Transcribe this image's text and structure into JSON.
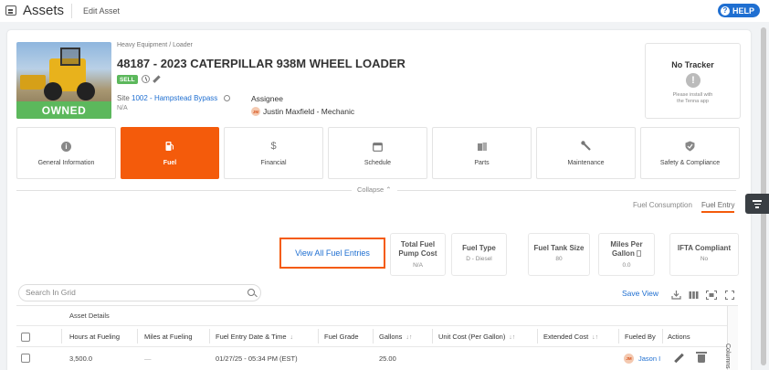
{
  "header": {
    "app_title": "Assets",
    "page_subtitle": "Edit Asset",
    "help_label": "HELP"
  },
  "asset": {
    "category": "Heavy Equipment / Loader",
    "name": "48187 - 2023 CATERPILLAR 938M WHEEL LOADER",
    "sell_badge": "SELL",
    "ownership_badge": "OWNED",
    "site_prefix": "Site",
    "site_link": "1002 - Hampstead Bypass",
    "site_secondary": "N/A",
    "assignee_label": "Assignee",
    "assignee_initials": "JM",
    "assignee_name": "Justin Maxfield - Mechanic"
  },
  "tracker": {
    "title": "No Tracker",
    "note_line1": "Please install with",
    "note_line2": "the Tenna app"
  },
  "tabs": [
    {
      "label": "General Information",
      "icon": "info-icon",
      "active": false
    },
    {
      "label": "Fuel",
      "icon": "fuel-icon",
      "active": true
    },
    {
      "label": "Financial",
      "icon": "dollar-icon",
      "active": false
    },
    {
      "label": "Schedule",
      "icon": "calendar-icon",
      "active": false
    },
    {
      "label": "Parts",
      "icon": "parts-icon",
      "active": false
    },
    {
      "label": "Maintenance",
      "icon": "wrench-icon",
      "active": false
    },
    {
      "label": "Safety & Compliance",
      "icon": "shield-check-icon",
      "active": false
    }
  ],
  "collapse_label": "Collapse ⌃",
  "sub_tabs": {
    "consumption": "Fuel Consumption",
    "entry": "Fuel Entry"
  },
  "fuel": {
    "view_all_label": "View All Fuel Entries",
    "stats": [
      {
        "title_line1": "Total Fuel",
        "title_line2": "Pump Cost",
        "value": "N/A"
      },
      {
        "title_line1": "Fuel Type",
        "title_line2": "",
        "value": "D - Diesel"
      },
      {
        "title_line1": "Fuel Tank Size",
        "title_line2": "",
        "value": "80"
      },
      {
        "title_line1": "Miles Per",
        "title_line2": "Gallon",
        "value": "0.0"
      },
      {
        "title_line1": "IFTA Compliant",
        "title_line2": "",
        "value": "No"
      }
    ]
  },
  "grid": {
    "search_placeholder": "Search In Grid",
    "save_view_label": "Save View",
    "group_header": "Asset Details",
    "columns": {
      "hours": "Hours at Fueling",
      "miles": "Miles at Fueling",
      "date": "Fuel Entry Date & Time",
      "grade": "Fuel Grade",
      "gallons": "Gallons",
      "unit_cost": "Unit Cost (Per Gallon)",
      "extended": "Extended Cost",
      "fueled_by": "Fueled By",
      "actions": "Actions"
    },
    "columns_panel_label": "Columns",
    "rows": [
      {
        "hours": "3,500.0",
        "miles": "—",
        "date": "01/27/25 - 05:34 PM (EST)",
        "grade": "",
        "gallons": "25.00",
        "unit_cost": "",
        "extended": "",
        "fueled_by_initials": "JM",
        "fueled_by": "Jason I"
      }
    ]
  },
  "colors": {
    "accent": "#f45b0b",
    "link": "#1f6fd1",
    "success": "#5cb85c"
  }
}
